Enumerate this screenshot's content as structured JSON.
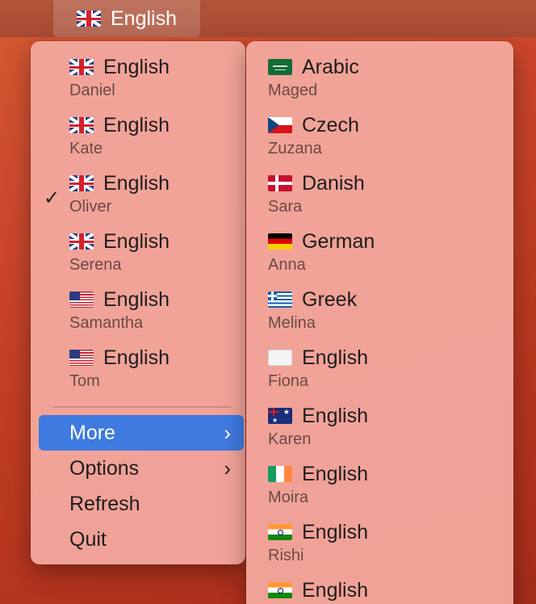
{
  "menubar": {
    "item": {
      "flag": "uk-flag",
      "label": "English"
    }
  },
  "main_menu": {
    "voices": [
      {
        "flag": "uk-flag",
        "language": "English",
        "voice": "Daniel",
        "checked": false
      },
      {
        "flag": "uk-flag",
        "language": "English",
        "voice": "Kate",
        "checked": false
      },
      {
        "flag": "uk-flag",
        "language": "English",
        "voice": "Oliver",
        "checked": true
      },
      {
        "flag": "uk-flag",
        "language": "English",
        "voice": "Serena",
        "checked": false
      },
      {
        "flag": "us-flag",
        "language": "English",
        "voice": "Samantha",
        "checked": false
      },
      {
        "flag": "us-flag",
        "language": "English",
        "voice": "Tom",
        "checked": false
      }
    ],
    "checkmark": "✓",
    "commands": [
      {
        "label": "More",
        "submenu": true,
        "highlighted": true
      },
      {
        "label": "Options",
        "submenu": true,
        "highlighted": false
      },
      {
        "label": "Refresh",
        "submenu": false,
        "highlighted": false
      },
      {
        "label": "Quit",
        "submenu": false,
        "highlighted": false
      }
    ],
    "chevron": "›"
  },
  "more_menu": {
    "voices": [
      {
        "flag": "saudi-arabia-flag",
        "language": "Arabic",
        "voice": "Maged"
      },
      {
        "flag": "czech-flag",
        "language": "Czech",
        "voice": "Zuzana"
      },
      {
        "flag": "denmark-flag",
        "language": "Danish",
        "voice": "Sara"
      },
      {
        "flag": "germany-flag",
        "language": "German",
        "voice": "Anna"
      },
      {
        "flag": "greece-flag",
        "language": "Greek",
        "voice": "Melina"
      },
      {
        "flag": "white-flag",
        "language": "English",
        "voice": "Fiona"
      },
      {
        "flag": "australia-flag",
        "language": "English",
        "voice": "Karen"
      },
      {
        "flag": "ireland-flag",
        "language": "English",
        "voice": "Moira"
      },
      {
        "flag": "india-flag",
        "language": "English",
        "voice": "Rishi"
      },
      {
        "flag": "india-flag",
        "language": "English",
        "voice": ""
      }
    ]
  },
  "colors": {
    "menu_background": "#f3a69c",
    "highlight": "#3f7ae0",
    "desktop": "#c9432a"
  }
}
